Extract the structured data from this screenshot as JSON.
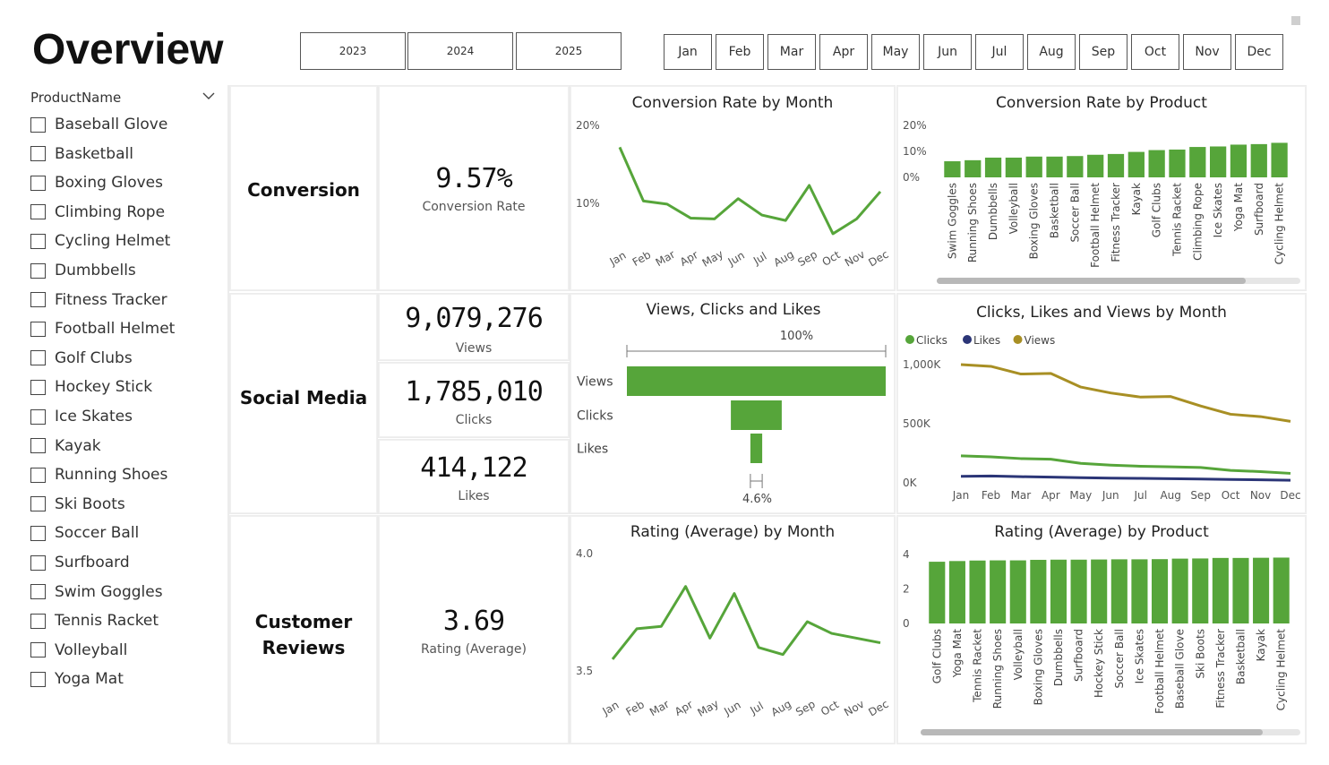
{
  "page": {
    "title": "Overview"
  },
  "years": [
    "2023",
    "2024",
    "2025"
  ],
  "months": [
    "Jan",
    "Feb",
    "Mar",
    "Apr",
    "May",
    "Jun",
    "Jul",
    "Aug",
    "Sep",
    "Oct",
    "Nov",
    "Dec"
  ],
  "slicer": {
    "header": "ProductName",
    "items": [
      "Baseball Glove",
      "Basketball",
      "Boxing Gloves",
      "Climbing Rope",
      "Cycling Helmet",
      "Dumbbells",
      "Fitness Tracker",
      "Football Helmet",
      "Golf Clubs",
      "Hockey Stick",
      "Ice Skates",
      "Kayak",
      "Running Shoes",
      "Ski Boots",
      "Soccer Ball",
      "Surfboard",
      "Swim Goggles",
      "Tennis Racket",
      "Volleyball",
      "Yoga Mat"
    ]
  },
  "rows": {
    "conversion": "Conversion",
    "social": "Social Media",
    "reviews": "Customer Reviews"
  },
  "kpis": {
    "conversion": {
      "value": "9.57%",
      "label": "Conversion Rate"
    },
    "views": {
      "value": "9,079,276",
      "label": "Views"
    },
    "clicks": {
      "value": "1,785,010",
      "label": "Clicks"
    },
    "likes": {
      "value": "414,122",
      "label": "Likes"
    },
    "rating": {
      "value": "3.69",
      "label": "Rating (Average)"
    }
  },
  "colors": {
    "green": "#56a53a",
    "navy": "#2b3577",
    "gold": "#a88f24",
    "accent": "#56a53a"
  },
  "chart_data": [
    {
      "id": "conv_month",
      "type": "line",
      "title": "Conversion Rate by Month",
      "categories": [
        "Jan",
        "Feb",
        "Mar",
        "Apr",
        "May",
        "Jun",
        "Jul",
        "Aug",
        "Sep",
        "Oct",
        "Nov",
        "Dec"
      ],
      "series": [
        {
          "values": [
            17.2,
            10.3,
            9.9,
            8.1,
            8.0,
            10.6,
            8.5,
            7.8,
            12.3,
            6.1,
            8.0,
            11.5
          ]
        }
      ],
      "yticks": [
        "20%",
        "10%"
      ],
      "ylim": [
        0,
        20
      ]
    },
    {
      "id": "conv_product",
      "type": "bar",
      "title": "Conversion Rate by Product",
      "categories": [
        "Swim Goggles",
        "Running Shoes",
        "Dumbbells",
        "Volleyball",
        "Boxing Gloves",
        "Basketball",
        "Soccer Ball",
        "Football Helmet",
        "Fitness Tracker",
        "Kayak",
        "Golf Clubs",
        "Tennis Racket",
        "Climbing Rope",
        "Ice Skates",
        "Yoga Mat",
        "Surfboard",
        "Cycling Helmet"
      ],
      "values": [
        6.2,
        6.6,
        7.6,
        7.6,
        8.0,
        8.0,
        8.2,
        8.7,
        9.0,
        9.8,
        10.5,
        10.7,
        11.7,
        11.9,
        12.6,
        12.8,
        13.3
      ],
      "yticks": [
        "20%",
        "10%",
        "0%"
      ],
      "ylim": [
        0,
        20
      ]
    },
    {
      "id": "funnel",
      "type": "bar",
      "title": "Views, Clicks and Likes",
      "categories": [
        "Views",
        "Clicks",
        "Likes"
      ],
      "values": [
        9079276,
        1785010,
        414122
      ],
      "top_label": "100%",
      "bottom_label": "4.6%"
    },
    {
      "id": "clv_month",
      "type": "line",
      "title": "Clicks, Likes and Views by Month",
      "categories": [
        "Jan",
        "Feb",
        "Mar",
        "Apr",
        "May",
        "Jun",
        "Jul",
        "Aug",
        "Sep",
        "Oct",
        "Nov",
        "Dec"
      ],
      "series": [
        {
          "name": "Clicks",
          "color": "#56a53a",
          "values": [
            228,
            220,
            205,
            200,
            165,
            150,
            140,
            135,
            130,
            105,
            95,
            80
          ]
        },
        {
          "name": "Likes",
          "color": "#2b3577",
          "values": [
            55,
            58,
            52,
            48,
            44,
            40,
            38,
            35,
            32,
            28,
            26,
            22
          ]
        },
        {
          "name": "Views",
          "color": "#a88f24",
          "values": [
            1000,
            985,
            920,
            925,
            810,
            760,
            725,
            730,
            650,
            580,
            560,
            520
          ]
        }
      ],
      "yticks": [
        "1,000K",
        "500K",
        "0K"
      ],
      "ylim": [
        0,
        1000
      ],
      "legend": "top-left"
    },
    {
      "id": "rating_month",
      "type": "line",
      "title": "Rating (Average) by Month",
      "categories": [
        "Jan",
        "Feb",
        "Mar",
        "Apr",
        "May",
        "Jun",
        "Jul",
        "Aug",
        "Sep",
        "Oct",
        "Nov",
        "Dec"
      ],
      "series": [
        {
          "values": [
            3.55,
            3.68,
            3.69,
            3.86,
            3.64,
            3.83,
            3.6,
            3.57,
            3.71,
            3.66,
            3.64,
            3.62
          ]
        }
      ],
      "yticks": [
        "4.0",
        "3.5"
      ],
      "ylim": [
        3.5,
        4.0
      ]
    },
    {
      "id": "rating_product",
      "type": "bar",
      "title": "Rating (Average) by Product",
      "categories": [
        "Golf Clubs",
        "Yoga Mat",
        "Tennis Racket",
        "Running Shoes",
        "Volleyball",
        "Boxing Gloves",
        "Dumbbells",
        "Surfboard",
        "Hockey Stick",
        "Soccer Ball",
        "Ice Skates",
        "Football Helmet",
        "Baseball Glove",
        "Ski Boots",
        "Fitness Tracker",
        "Basketball",
        "Kayak",
        "Cycling Helmet"
      ],
      "values": [
        3.58,
        3.62,
        3.65,
        3.66,
        3.66,
        3.69,
        3.7,
        3.7,
        3.71,
        3.72,
        3.72,
        3.73,
        3.76,
        3.77,
        3.8,
        3.8,
        3.81,
        3.82
      ],
      "yticks": [
        "4",
        "2",
        "0"
      ],
      "ylim": [
        0,
        4
      ]
    }
  ]
}
